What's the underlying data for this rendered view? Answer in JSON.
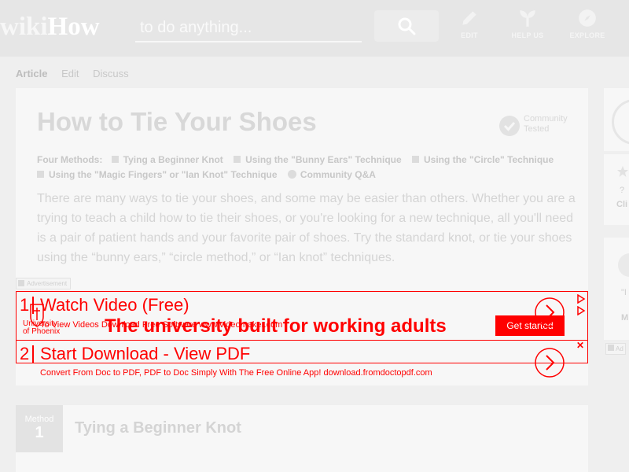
{
  "header": {
    "logo_wiki": "wiki",
    "logo_how": "How",
    "search_placeholder": "to do anything...",
    "nav": [
      {
        "label": "EDIT",
        "icon": "pencil-icon"
      },
      {
        "label": "HELP US",
        "icon": "sprout-icon"
      },
      {
        "label": "EXPLORE",
        "icon": "compass-icon"
      }
    ]
  },
  "tabs": [
    {
      "label": "Article",
      "active": true
    },
    {
      "label": "Edit",
      "active": false
    },
    {
      "label": "Discuss",
      "active": false
    }
  ],
  "article": {
    "title": "How to Tie Your Shoes",
    "badge_line1": "Community",
    "badge_line2": "Tested",
    "methods_label": "Four Methods:",
    "methods": [
      "Tying a Beginner Knot",
      "Using the \"Bunny Ears\" Technique",
      "Using the \"Circle\" Technique",
      "Using the \"Magic Fingers\" or \"Ian Knot\" Technique"
    ],
    "qa_label": "Community Q&A",
    "intro": "There are many ways to tie your shoes, and some may be easier than others. Whether you are a trying to teach a child how to tie their shoes, or you're looking for a new technique, all you'll need is a pair of patient hands and your favorite pair of shoes. Try the standard knot, or tie your shoes using the “bunny ears,” “circle method,” or “Ian knot” techniques."
  },
  "ads": {
    "label": "Advertisement",
    "item1_num": "1",
    "item1_headline": "Watch Video (Free)",
    "item1_sub": "To View Videos Download Free Software www.videomaker.com",
    "university_name_line1": "University",
    "university_name_line2": "of Phoenix",
    "university_headline": "The university built for working adults",
    "cta": "Get started",
    "item2_num": "2",
    "item2_headline": "Start Download - View PDF",
    "item2_sub": "Convert From Doc to PDF, PDF to Doc Simply With The Free Online App! download.fromdoctopdf.com",
    "close": "✕",
    "color": "#ff0000"
  },
  "method": {
    "label": "Method",
    "number": "1",
    "title": "Tying a Beginner Knot"
  },
  "sidebar": {
    "tiny": "?",
    "cut1": "Cli",
    "cut2": "\"I",
    "cut3": "M",
    "cut4": "Ad"
  }
}
